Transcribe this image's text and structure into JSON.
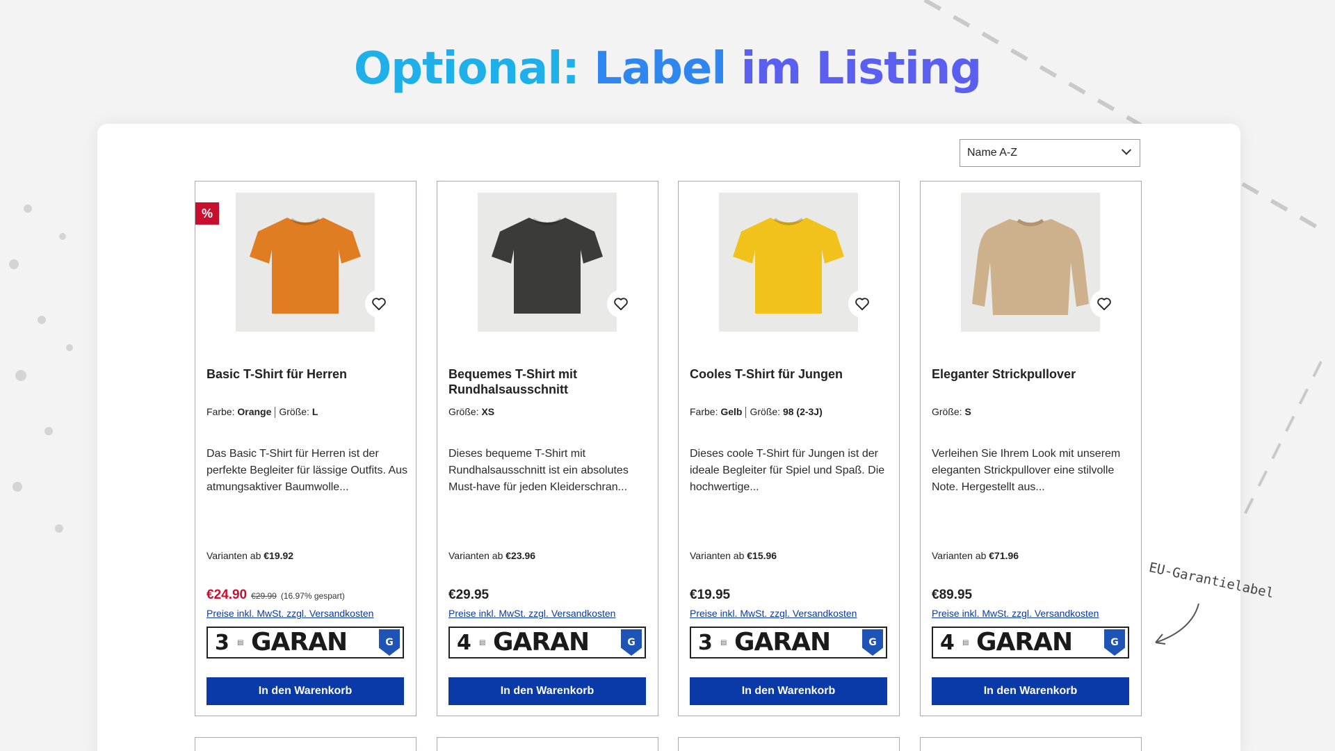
{
  "headline": {
    "part1": "Optional:",
    "part2": "Label",
    "part3": "im Listing"
  },
  "sort": {
    "selected": "Name A-Z"
  },
  "annotation": "EU-Garantielabel",
  "common": {
    "tax_note": "Preise inkl. MwSt. zzgl. Versandkosten",
    "cart_label": "In den Warenkorb",
    "variants_prefix": "Varianten ab",
    "garantie_word": "GARAN",
    "sale_badge": "%",
    "color_label": "Farbe:",
    "size_label": "Größe:"
  },
  "products": [
    {
      "title": "Basic T-Shirt für Herren",
      "color": "Orange",
      "size": "L",
      "description": "Das Basic T-Shirt für Herren ist der perfekte Begleiter für lässige Outfits. Aus atmungsaktiver Baumwolle...",
      "variants_price": "€19.92",
      "price": "€24.90",
      "old_price": "€29.99",
      "saved": "(16.97% gespart)",
      "garantie_years": "3",
      "image_icon": "orange-tshirt",
      "shirt_color": "#e07d22"
    },
    {
      "title": "Bequemes T-Shirt mit Rundhalsausschnitt",
      "size": "XS",
      "description": "Dieses bequeme T-Shirt mit Rundhalsausschnitt ist ein absolutes Must-have für jeden Kleiderschran...",
      "variants_price": "€23.96",
      "price": "€29.95",
      "garantie_years": "4",
      "image_icon": "dark-tshirt",
      "shirt_color": "#3b3b39"
    },
    {
      "title": "Cooles T-Shirt für Jungen",
      "color": "Gelb",
      "size": "98 (2-3J)",
      "description": "Dieses coole T-Shirt für Jungen ist der ideale Begleiter für Spiel und Spaß. Die hochwertige...",
      "variants_price": "€15.96",
      "price": "€19.95",
      "garantie_years": "3",
      "image_icon": "yellow-tshirt",
      "shirt_color": "#f2c21c"
    },
    {
      "title": "Eleganter Strickpullover",
      "size": "S",
      "description": "Verleihen Sie Ihrem Look mit unserem eleganten Strickpullover eine stilvolle Note. Hergestellt aus...",
      "variants_price": "€71.96",
      "price": "€89.95",
      "garantie_years": "4",
      "image_icon": "beige-sweater",
      "shirt_color": "#cdb08c"
    }
  ]
}
